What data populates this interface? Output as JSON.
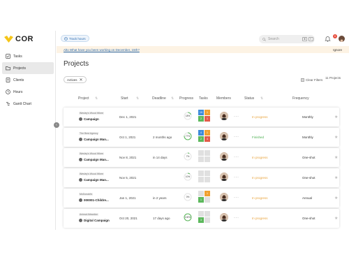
{
  "app": {
    "logo_text": "COR"
  },
  "sidebar": {
    "items": [
      {
        "label": "Tasks",
        "icon": "tasks-icon",
        "active": false
      },
      {
        "label": "Projects",
        "icon": "projects-icon",
        "active": true
      },
      {
        "label": "Clients",
        "icon": "clients-icon",
        "active": false
      },
      {
        "label": "Hours",
        "icon": "clock-icon",
        "active": false
      },
      {
        "label": "Gantt Chart",
        "icon": "gantt-icon",
        "active": false
      }
    ]
  },
  "topbar": {
    "track_label": "Track hours",
    "search_placeholder": "Search",
    "kbd1": "⌘",
    "kbd2": "K",
    "notification_count": "6"
  },
  "notice": {
    "link_text": "Alto What have you been working on December, 15th?",
    "ignore_label": "Ignore"
  },
  "page": {
    "title": "Projects",
    "filter_chip": "Actives",
    "clear_filters": "Clear Filters",
    "count": "11 Projects"
  },
  "table": {
    "headers": {
      "project": "Project",
      "start": "Start",
      "deadline": "Deadline",
      "progress": "Progress",
      "tasks": "Tasks",
      "members": "Members",
      "status": "Status",
      "frequency": "Frequency"
    },
    "rows": [
      {
        "client": "Wesley's Wood Whee",
        "name": "Campaign",
        "start": "Dec 1, 2021",
        "deadline": "",
        "progress": "18%",
        "progress_value": 18,
        "tasks": [
          "19",
          "1",
          "2",
          "1"
        ],
        "status": "In progress",
        "status_color": "#e8a33d",
        "frequency": "Monthly"
      },
      {
        "client": "The Best Agency",
        "name": "Campaign Man...",
        "start": "Oct 1, 2021",
        "deadline": "2 months ago",
        "progress": "77%",
        "progress_value": 77,
        "tasks": [
          "4",
          "1",
          "2",
          "4"
        ],
        "status": "Finished",
        "status_color": "#4caf50",
        "frequency": "Monthly"
      },
      {
        "client": "Wesley's Wood Whee",
        "name": "Campaign Man...",
        "start": "Nov 8, 2021",
        "deadline": "in 14 days",
        "progress": "7%",
        "progress_value": 7,
        "tasks": [
          "",
          "",
          "",
          ""
        ],
        "status": "In progress",
        "status_color": "#e8a33d",
        "frequency": "One-shot"
      },
      {
        "client": "Wesley's Wood Whee",
        "name": "Campaign Man...",
        "start": "Nov 5, 2021",
        "deadline": "",
        "progress": "10%",
        "progress_value": 10,
        "tasks": [
          "",
          "",
          "",
          ""
        ],
        "status": "In progress",
        "status_color": "#e8a33d",
        "frequency": "One-shot"
      },
      {
        "client": "McDonald's",
        "name": "000001-Childre...",
        "start": "Jan 1, 2021",
        "deadline": "in 2 years",
        "progress": "0%",
        "progress_value": 0,
        "tasks": [
          "",
          "1",
          "1",
          ""
        ],
        "status": "In progress",
        "status_color": "#e8a33d",
        "frequency": "Annual"
      },
      {
        "client": "Animal Attraction",
        "name": "Digital Campaign",
        "start": "Oct 20, 2021",
        "deadline": "17 days ago",
        "progress": "100%",
        "progress_value": 100,
        "tasks": [
          "",
          "",
          "3",
          ""
        ],
        "status": "In progress",
        "status_color": "#e8a33d",
        "frequency": "One-shot"
      }
    ]
  },
  "colors": {
    "accent": "#2a6bb0",
    "logo_yellow": "#f5c518",
    "in_progress": "#e8a33d",
    "finished": "#4caf50",
    "task_blue": "#3d8bd9",
    "task_orange": "#f0a030",
    "task_green": "#5cb85c",
    "task_red": "#e25c4a"
  }
}
